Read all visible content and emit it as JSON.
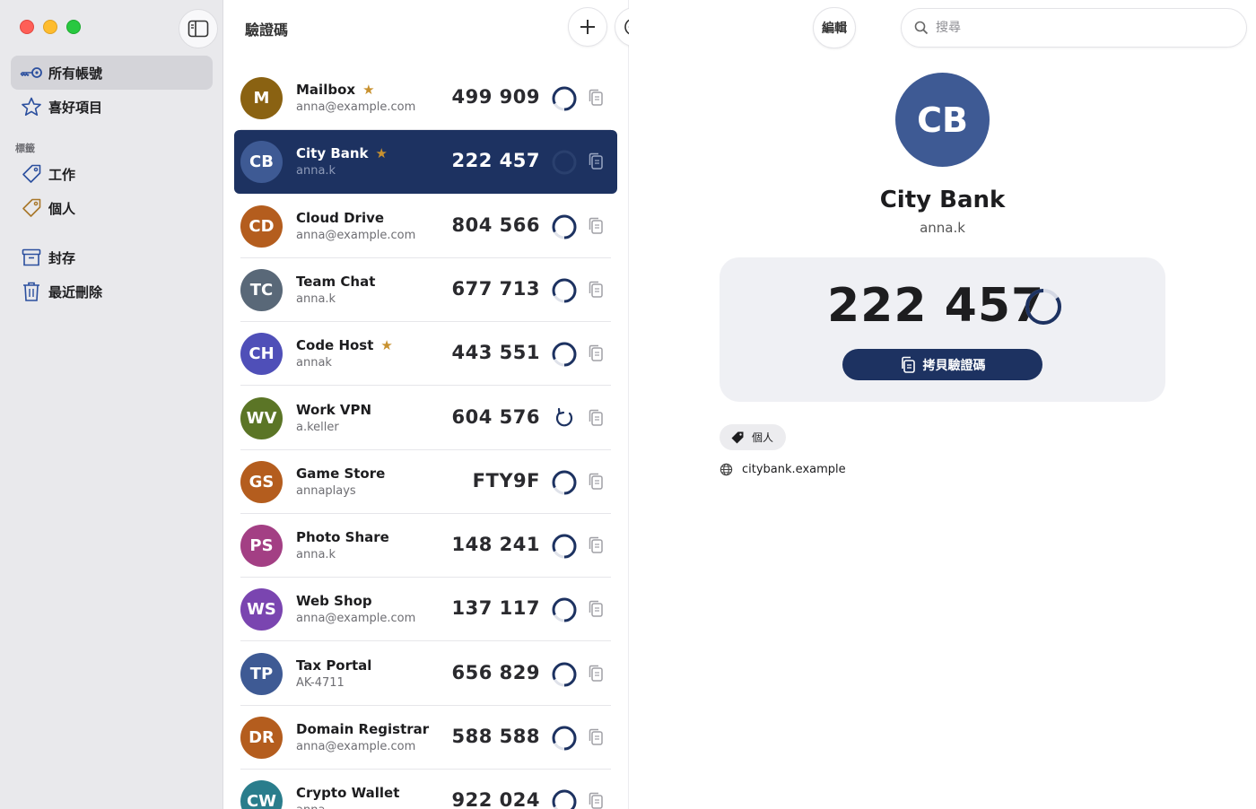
{
  "sidebar": {
    "items": [
      {
        "label": "所有帳號",
        "icon": "key-icon"
      },
      {
        "label": "喜好項目",
        "icon": "star-icon"
      }
    ],
    "tags_header": "標籤",
    "tags": [
      {
        "label": "工作",
        "icon": "tag-icon"
      },
      {
        "label": "個人",
        "icon": "tag-icon"
      }
    ],
    "other": [
      {
        "label": "封存",
        "icon": "archive-icon"
      },
      {
        "label": "最近刪除",
        "icon": "trash-icon"
      }
    ]
  },
  "list": {
    "title": "驗證碼",
    "accounts": [
      {
        "initials": "M",
        "name": "Mailbox",
        "sub": "anna@example.com",
        "code": "499 909",
        "favorite": true,
        "color": "#8a6212",
        "timer": "ring"
      },
      {
        "initials": "CB",
        "name": "City Bank",
        "sub": "anna.k",
        "code": "222 457",
        "favorite": true,
        "color": "#3e5a94",
        "timer": "ring",
        "selected": true
      },
      {
        "initials": "CD",
        "name": "Cloud Drive",
        "sub": "anna@example.com",
        "code": "804 566",
        "favorite": false,
        "color": "#b45d1e",
        "timer": "ring"
      },
      {
        "initials": "TC",
        "name": "Team Chat",
        "sub": "anna.k",
        "code": "677 713",
        "favorite": false,
        "color": "#596878",
        "timer": "ring"
      },
      {
        "initials": "CH",
        "name": "Code Host",
        "sub": "annak",
        "code": "443 551",
        "favorite": true,
        "color": "#4f4fb8",
        "timer": "ring"
      },
      {
        "initials": "WV",
        "name": "Work VPN",
        "sub": "a.keller",
        "code": "604 576",
        "favorite": false,
        "color": "#5b7526",
        "timer": "refresh"
      },
      {
        "initials": "GS",
        "name": "Game Store",
        "sub": "annaplays",
        "code": "FTY9F",
        "favorite": false,
        "color": "#b45d1e",
        "timer": "ring"
      },
      {
        "initials": "PS",
        "name": "Photo Share",
        "sub": "anna.k",
        "code": "148 241",
        "favorite": false,
        "color": "#a33f84",
        "timer": "ring"
      },
      {
        "initials": "WS",
        "name": "Web Shop",
        "sub": "anna@example.com",
        "code": "137 117",
        "favorite": false,
        "color": "#7a45b0",
        "timer": "ring"
      },
      {
        "initials": "TP",
        "name": "Tax Portal",
        "sub": "AK-4711",
        "code": "656 829",
        "favorite": false,
        "color": "#3e5a94",
        "timer": "ring"
      },
      {
        "initials": "DR",
        "name": "Domain Registrar",
        "sub": "anna@example.com",
        "code": "588 588",
        "favorite": false,
        "color": "#b45d1e",
        "timer": "ring"
      },
      {
        "initials": "CW",
        "name": "Crypto Wallet",
        "sub": "anna",
        "code": "922 024",
        "favorite": false,
        "color": "#2a7d8c",
        "timer": "ring"
      }
    ]
  },
  "toolbar": {
    "add_icon": "plus-icon",
    "more_icon": "ellipsis-circle-icon",
    "lock_icon": "lock-icon",
    "edit_label": "編輯",
    "search_placeholder": "搜尋"
  },
  "detail": {
    "initials": "CB",
    "name": "City Bank",
    "sub": "anna.k",
    "code": "222 457",
    "copy_label": "拷貝驗證碼",
    "tag": "個人",
    "website": "citybank.example",
    "accent": "#1d3261"
  }
}
